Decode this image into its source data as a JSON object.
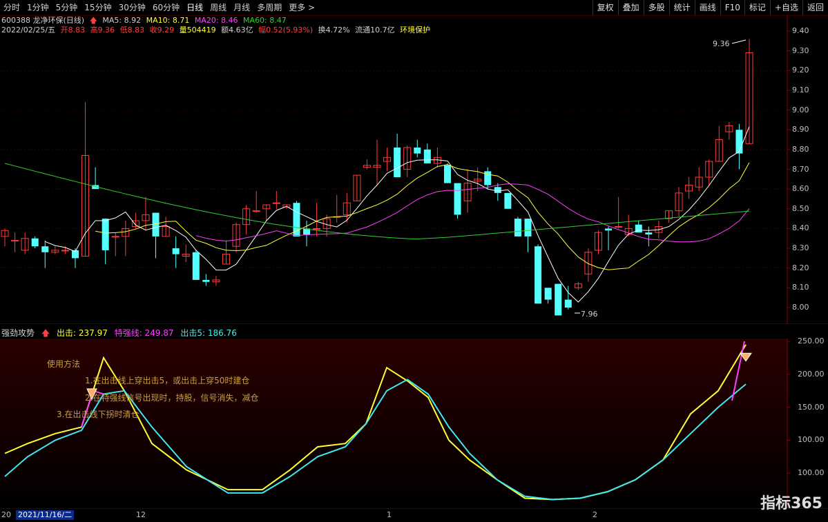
{
  "topbar": {
    "tabs": [
      "分时",
      "1分钟",
      "5分钟",
      "15分钟",
      "30分钟",
      "60分钟",
      "日线",
      "周线",
      "月线",
      "多周期",
      "更多 >"
    ],
    "active_tab": "日线",
    "right_buttons": [
      "复权",
      "叠加",
      "多股",
      "统计",
      "画线",
      "F10",
      "标记",
      "+自选",
      "返回"
    ]
  },
  "info": {
    "stock": "600388 龙净环保(日线)",
    "ma5": "MA5: 8.92",
    "ma10": "MA10: 8.71",
    "ma20": "MA20: 8.46",
    "ma60": "MA60: 8.47",
    "date": "2022/02/25/五",
    "open": "开8.83",
    "high": "高9.36",
    "low": "低8.83",
    "close": "收9.29",
    "vol": "量504419",
    "amount": "额4.63亿",
    "change": "幅0.52(5.93%)",
    "turnover": "换4.72%",
    "float": "流通10.7亿",
    "concept": "环境保护"
  },
  "price_axis": [
    "9.40",
    "9.30",
    "9.20",
    "9.10",
    "9.00",
    "8.90",
    "8.80",
    "8.70",
    "8.60",
    "8.50",
    "8.40",
    "8.30",
    "8.20",
    "8.10",
    "8.00"
  ],
  "annotations": {
    "high": "9.36",
    "low": "7.96"
  },
  "indicator": {
    "name": "强劲攻势",
    "chuji": "出击: 237.97",
    "teqiang": "特强线: 249.87",
    "chuji5": "出击5: 186.76",
    "axis": [
      "250.00",
      "200.00",
      "150.00",
      "100.00",
      "100.00"
    ],
    "notes": [
      "使用方法",
      "1.在出击线上穿出击5，或出击上穿50时建仓",
      "2.在特强线信号出现时，持股，信号消失，减仓",
      "3.在出击线下拐时清仓"
    ]
  },
  "bottombar": {
    "date_box": "2021/11/16/二",
    "x_labels": [
      "12",
      "1",
      "2"
    ],
    "left_label": "20"
  },
  "logo": "指标365",
  "chart_data": {
    "type": "candlestick",
    "candles": [
      [
        8.36,
        8.4,
        8.31,
        8.39
      ],
      [
        8.34,
        8.38,
        8.28,
        8.34
      ],
      [
        8.29,
        8.38,
        8.27,
        8.35
      ],
      [
        8.35,
        8.36,
        8.3,
        8.31
      ],
      [
        8.31,
        8.34,
        8.2,
        8.28
      ],
      [
        8.28,
        8.31,
        8.27,
        8.29
      ],
      [
        8.29,
        8.31,
        8.27,
        8.29
      ],
      [
        8.29,
        8.3,
        8.2,
        8.25
      ],
      [
        8.26,
        9.04,
        8.26,
        8.77
      ],
      [
        8.62,
        8.71,
        8.62,
        8.6
      ],
      [
        8.45,
        8.45,
        8.22,
        8.29
      ],
      [
        8.36,
        8.38,
        8.26,
        8.36
      ],
      [
        8.36,
        8.44,
        8.26,
        8.4
      ],
      [
        8.41,
        8.48,
        8.4,
        8.44
      ],
      [
        8.44,
        8.56,
        8.39,
        8.47
      ],
      [
        8.48,
        8.48,
        8.25,
        8.36
      ],
      [
        8.36,
        8.46,
        8.36,
        8.41
      ],
      [
        8.3,
        8.36,
        8.2,
        8.27
      ],
      [
        8.26,
        8.32,
        8.23,
        8.27
      ],
      [
        8.28,
        8.29,
        8.15,
        8.14
      ],
      [
        8.14,
        8.17,
        8.11,
        8.13
      ],
      [
        8.13,
        8.16,
        8.11,
        8.14
      ],
      [
        8.22,
        8.34,
        8.22,
        8.27
      ],
      [
        8.31,
        8.43,
        8.28,
        8.42
      ],
      [
        8.42,
        8.52,
        8.37,
        8.5
      ],
      [
        8.49,
        8.59,
        8.48,
        8.49
      ],
      [
        8.5,
        8.52,
        8.44,
        8.52
      ],
      [
        8.53,
        8.59,
        8.5,
        8.53
      ],
      [
        8.51,
        8.52,
        8.5,
        8.52
      ],
      [
        8.53,
        8.54,
        8.36,
        8.36
      ],
      [
        8.4,
        8.44,
        8.31,
        8.37
      ],
      [
        8.4,
        8.53,
        8.36,
        8.4
      ],
      [
        8.4,
        8.47,
        8.36,
        8.45
      ],
      [
        8.46,
        8.57,
        8.43,
        8.46
      ],
      [
        8.47,
        8.58,
        8.43,
        8.53
      ],
      [
        8.54,
        8.67,
        8.54,
        8.67
      ],
      [
        8.71,
        8.75,
        8.7,
        8.72
      ],
      [
        8.71,
        8.85,
        8.62,
        8.72
      ],
      [
        8.74,
        8.81,
        8.69,
        8.76
      ],
      [
        8.81,
        8.88,
        8.66,
        8.66
      ],
      [
        8.7,
        8.82,
        8.66,
        8.81
      ],
      [
        8.81,
        8.85,
        8.76,
        8.78
      ],
      [
        8.8,
        8.83,
        8.74,
        8.73
      ],
      [
        8.73,
        8.81,
        8.71,
        8.76
      ],
      [
        8.72,
        8.73,
        8.63,
        8.63
      ],
      [
        8.63,
        8.62,
        8.45,
        8.47
      ],
      [
        8.54,
        8.7,
        8.48,
        8.63
      ],
      [
        8.64,
        8.71,
        8.59,
        8.65
      ],
      [
        8.69,
        8.71,
        8.6,
        8.62
      ],
      [
        8.61,
        8.63,
        8.54,
        8.58
      ],
      [
        8.58,
        8.58,
        8.5,
        8.5
      ],
      [
        8.45,
        8.46,
        8.36,
        8.36
      ],
      [
        8.45,
        8.45,
        8.28,
        8.36
      ],
      [
        8.31,
        8.32,
        8.02,
        8.02
      ],
      [
        8.1,
        8.1,
        8.02,
        8.04
      ],
      [
        8.12,
        8.11,
        7.96,
        7.96
      ],
      [
        8.04,
        8.11,
        7.99,
        8.0
      ],
      [
        8.1,
        8.13,
        8.09,
        8.12
      ],
      [
        8.17,
        8.3,
        8.13,
        8.28
      ],
      [
        8.29,
        8.39,
        8.27,
        8.38
      ],
      [
        8.4,
        8.41,
        8.29,
        8.39
      ],
      [
        8.41,
        8.56,
        8.4,
        8.41
      ],
      [
        8.37,
        8.47,
        8.36,
        8.4
      ],
      [
        8.42,
        8.44,
        8.38,
        8.38
      ],
      [
        8.38,
        8.41,
        8.31,
        8.37
      ],
      [
        8.38,
        8.44,
        8.35,
        8.41
      ],
      [
        8.45,
        8.49,
        8.43,
        8.49
      ],
      [
        8.49,
        8.61,
        8.46,
        8.58
      ],
      [
        8.59,
        8.66,
        8.55,
        8.62
      ],
      [
        8.61,
        8.71,
        8.59,
        8.66
      ],
      [
        8.66,
        8.75,
        8.62,
        8.74
      ],
      [
        8.74,
        8.92,
        8.74,
        8.85
      ],
      [
        8.89,
        8.94,
        8.85,
        8.92
      ],
      [
        8.9,
        8.93,
        8.7,
        8.78
      ],
      [
        8.83,
        9.36,
        8.83,
        9.29
      ]
    ]
  }
}
